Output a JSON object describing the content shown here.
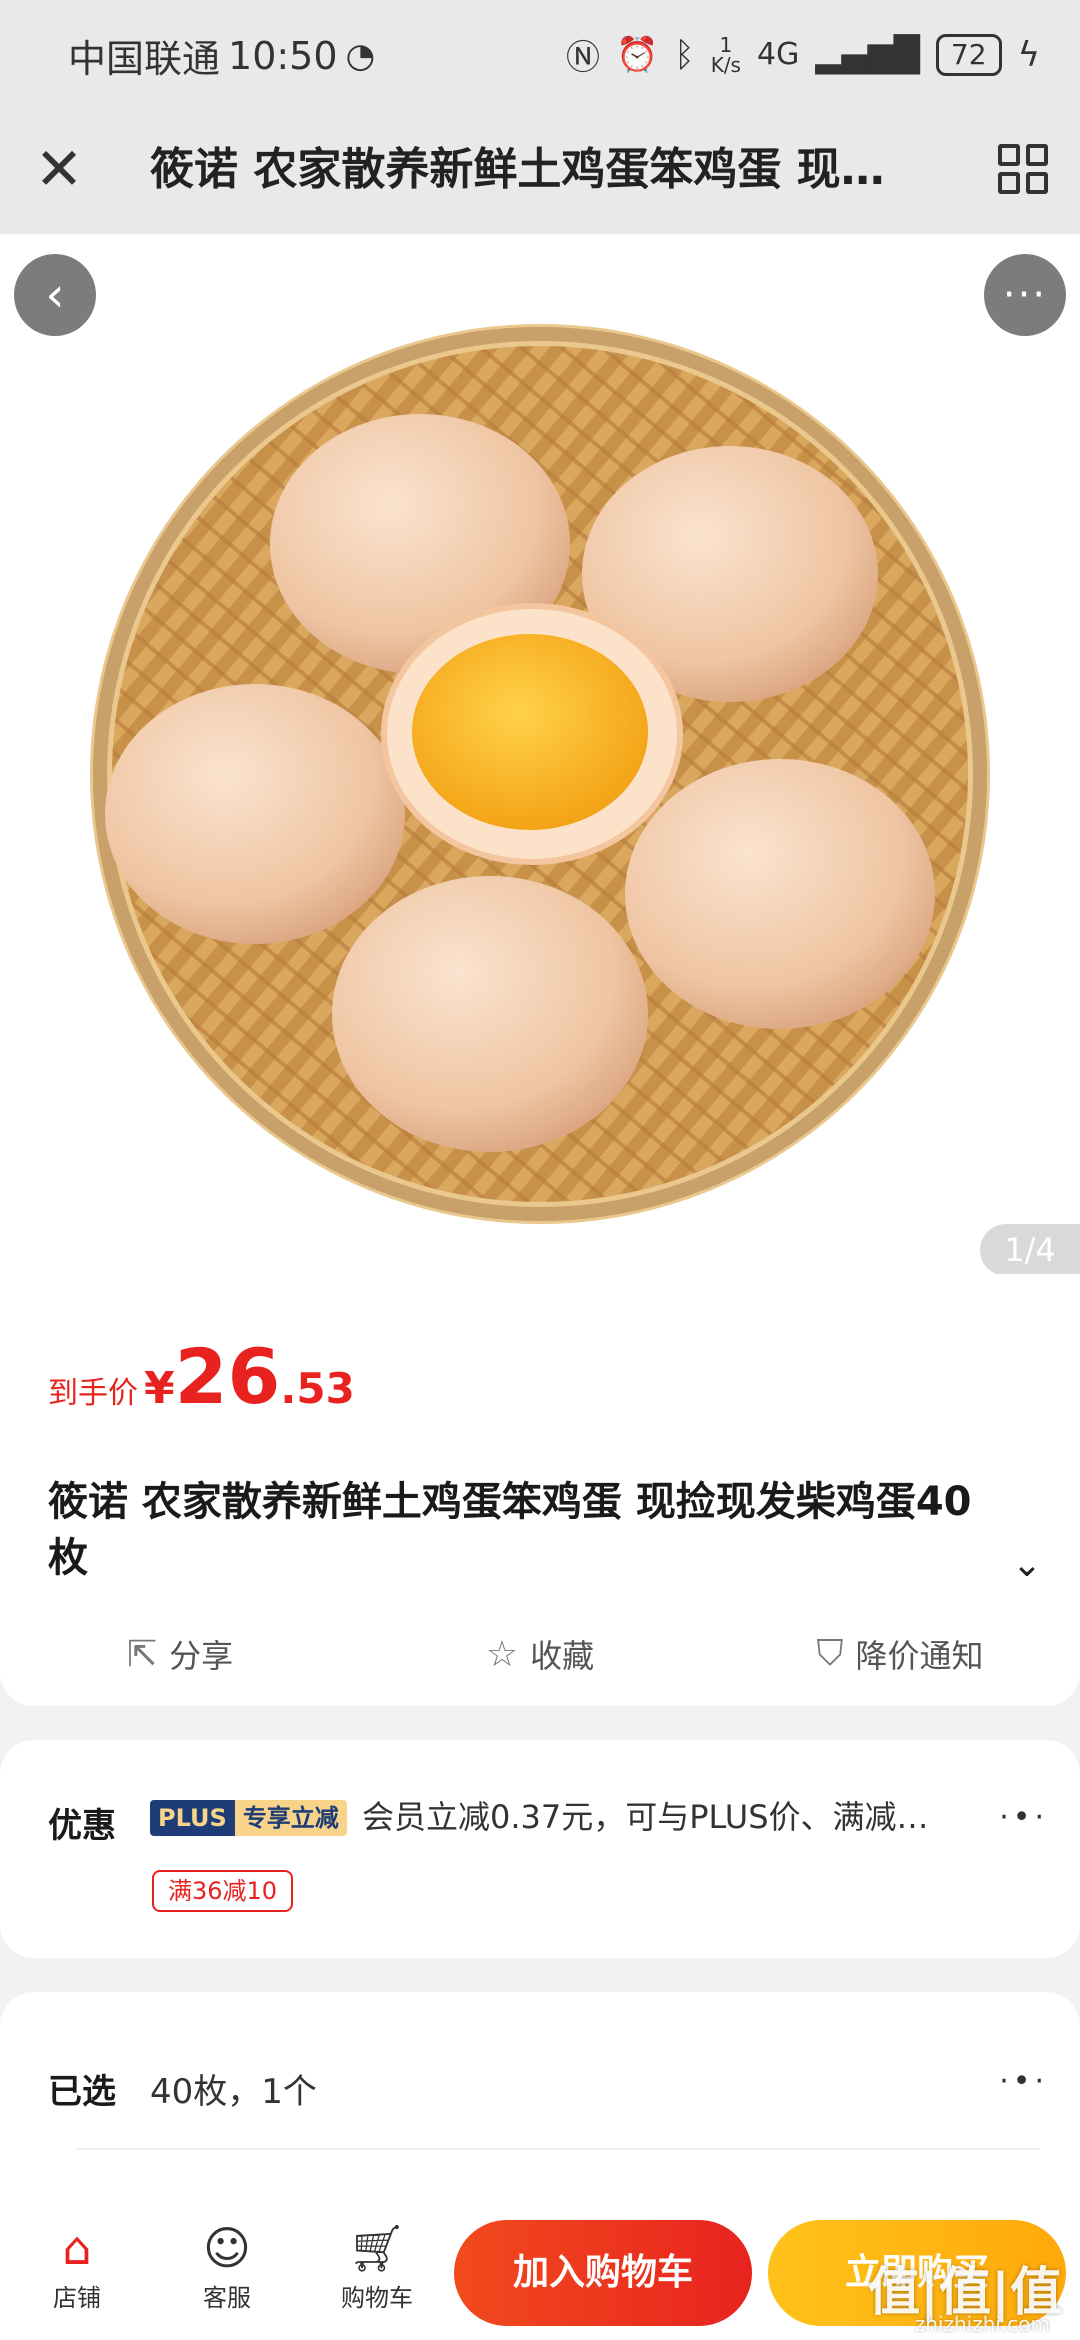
{
  "status_bar": {
    "carrier": "中国联通",
    "time": "10:50",
    "net_speed_top": "1",
    "net_speed_bottom": "K/s",
    "network": "4G",
    "battery": "72"
  },
  "nav": {
    "title": "筱诺 农家散养新鲜土鸡蛋笨鸡蛋 现…"
  },
  "hero": {
    "page_indicator": "1/4",
    "more_glyph": "···"
  },
  "price": {
    "label": "到手价",
    "currency": "¥",
    "integer": "26",
    "decimal": ".53",
    "color": "#e8231f"
  },
  "product": {
    "title": "筱诺 农家散养新鲜土鸡蛋笨鸡蛋 现捡现发柴鸡蛋40枚"
  },
  "actions": [
    {
      "label": "分享",
      "icon": "share-icon"
    },
    {
      "label": "收藏",
      "icon": "star-icon"
    },
    {
      "label": "降价通知",
      "icon": "price-alert-icon"
    }
  ],
  "promo": {
    "label": "优惠",
    "badge_plus": "PLUS",
    "badge_text": "专享立减",
    "text": "会员立减0.37元，可与PLUS价、满减…",
    "coupon": "满36减10"
  },
  "selected": {
    "label": "已选",
    "value": "40枚，1个"
  },
  "bottom_bar": {
    "store": "店铺",
    "service": "客服",
    "cart": "购物车",
    "add_to_cart": "加入购物车",
    "buy_now": "立即购买"
  },
  "watermark": {
    "main": "值|值|值",
    "sub": "zhizhizhi.com"
  }
}
